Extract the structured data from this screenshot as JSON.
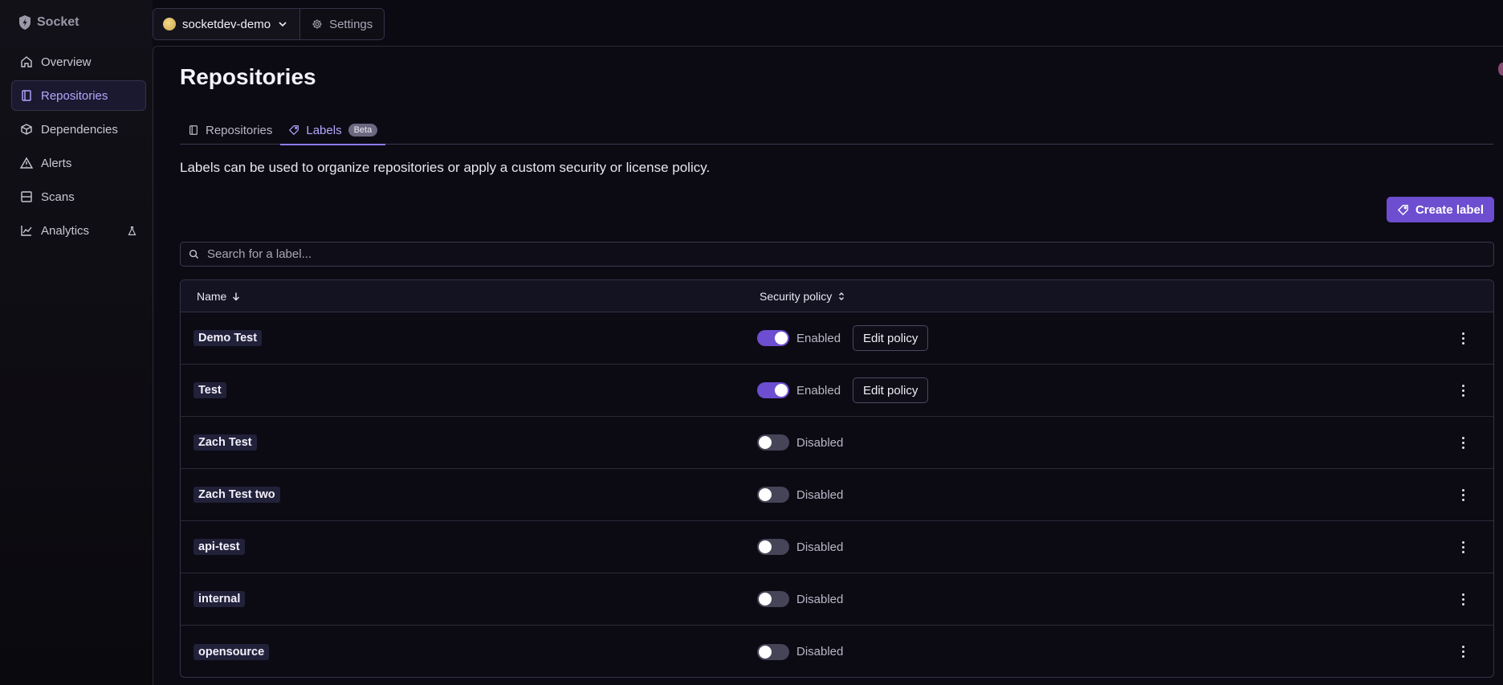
{
  "brand": {
    "name": "Socket"
  },
  "sidebar": {
    "items": [
      {
        "label": "Overview",
        "icon": "home-icon"
      },
      {
        "label": "Repositories",
        "icon": "book-icon",
        "active": true
      },
      {
        "label": "Dependencies",
        "icon": "package-icon"
      },
      {
        "label": "Alerts",
        "icon": "warning-icon"
      },
      {
        "label": "Scans",
        "icon": "scan-icon"
      },
      {
        "label": "Analytics",
        "icon": "chart-icon",
        "badge_icon": "flask-icon"
      }
    ]
  },
  "topbar": {
    "org_name": "socketdev-demo",
    "settings_label": "Settings"
  },
  "page": {
    "title": "Repositories",
    "tabs": [
      {
        "label": "Repositories",
        "icon": "book-icon",
        "active": false
      },
      {
        "label": "Labels",
        "icon": "tag-icon",
        "active": true,
        "badge": "Beta"
      }
    ],
    "description": "Labels can be used to organize repositories or apply a custom security or license policy.",
    "create_label": "Create label",
    "search_placeholder": "Search for a label..."
  },
  "table": {
    "columns": {
      "name": "Name",
      "security_policy": "Security policy"
    },
    "edit_policy_label": "Edit policy",
    "rows": [
      {
        "name": "Demo Test",
        "enabled": true,
        "status": "Enabled"
      },
      {
        "name": "Test",
        "enabled": true,
        "status": "Enabled"
      },
      {
        "name": "Zach Test",
        "enabled": false,
        "status": "Disabled"
      },
      {
        "name": "Zach Test two",
        "enabled": false,
        "status": "Disabled"
      },
      {
        "name": "api-test",
        "enabled": false,
        "status": "Disabled"
      },
      {
        "name": "internal",
        "enabled": false,
        "status": "Disabled"
      },
      {
        "name": "opensource",
        "enabled": false,
        "status": "Disabled"
      }
    ]
  },
  "colors": {
    "accent": "#6d4ed0",
    "accent_text": "#b7a6ff",
    "background": "#0b0a12"
  }
}
